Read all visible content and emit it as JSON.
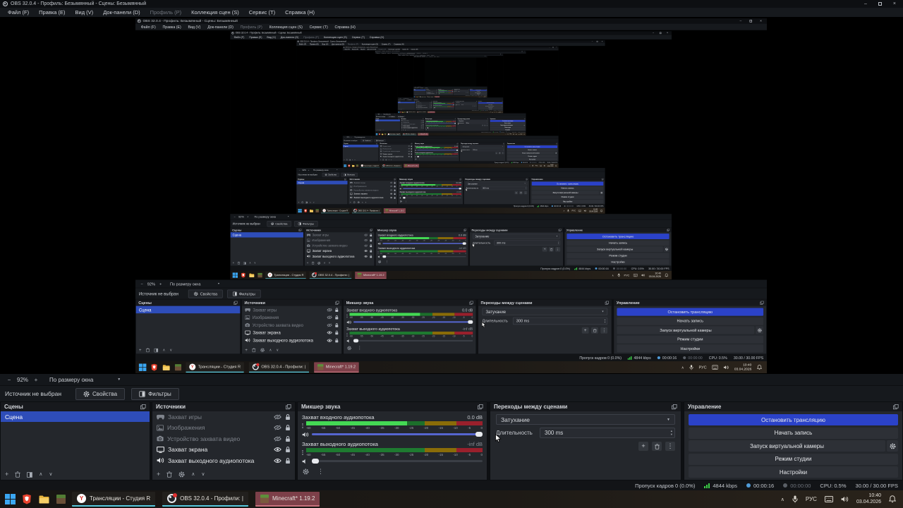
{
  "window": {
    "title": "OBS 32.0.4 - Профиль: Безымянный - Сцены: Безымянный",
    "menu": {
      "file": "Файл (F)",
      "edit": "Правка (E)",
      "view": "Вид (V)",
      "docks": "Док-панели (D)",
      "profile": "Профиль (P)",
      "scene_collection": "Коллекция сцен (S)",
      "tools": "Сервис (T)",
      "help": "Справка (H)"
    },
    "controls": {
      "minimize": "–",
      "close": "×"
    }
  },
  "preview_toolbar": {
    "zoom_out": "−",
    "zoom_level": "92%",
    "zoom_in": "+",
    "fit_mode": "По размеру окна"
  },
  "context_bar": {
    "status": "Источник не выбран",
    "properties": "Свойства",
    "filters": "Фильтры"
  },
  "scenes": {
    "title": "Сцены",
    "items": [
      {
        "name": "Сцена",
        "selected": true
      }
    ]
  },
  "sources": {
    "title": "Источники",
    "items": [
      {
        "name": "Захват игры",
        "visible": false,
        "locked": true
      },
      {
        "name": "Изображения",
        "visible": false,
        "locked": true
      },
      {
        "name": "Устройство захвата видео",
        "visible": false,
        "locked": true
      },
      {
        "name": "Захват экрана",
        "visible": true,
        "locked": true
      },
      {
        "name": "Захват выходного аудиопотока",
        "visible": true,
        "locked": true
      }
    ]
  },
  "mixer": {
    "title": "Микшер звука",
    "channel1": {
      "name": "Захват входного аудиопотока",
      "db": "0.0 dB",
      "level_pct": 57,
      "volume_pct": 100
    },
    "channel2": {
      "name": "Захват выходного аудиопотока",
      "db": "-inf dB",
      "level_pct": 0,
      "volume_pct": 0
    },
    "ticks": [
      "-60",
      "-55",
      "-50",
      "-45",
      "-40",
      "-35",
      "-30",
      "-25",
      "-20",
      "-15",
      "-10",
      "-5",
      "0"
    ]
  },
  "transitions": {
    "title": "Переходы между сценами",
    "current": "Затухание",
    "duration_label": "Длительность",
    "duration_value": "300 ms"
  },
  "controls_dock": {
    "title": "Управление",
    "stop_stream": "Остановить трансляцию",
    "start_record": "Начать запись",
    "virtual_camera": "Запуск виртуальной камеры",
    "studio_mode": "Режим студии",
    "settings": "Настройки"
  },
  "status_bar": {
    "dropped_frames": "Пропуск кадров 0 (0.0%)",
    "bitrate": "4844 kbps",
    "stream_time": "00:00:16",
    "record_time": "00:00:00",
    "cpu": "CPU: 0.5%",
    "fps": "30.00 / 30.00 FPS"
  },
  "taskbar": {
    "studio_button": "Трансляции - Студия R",
    "obs_button": "OBS 32.0.4 - Профили: |",
    "minecraft_button": "Minecraft* 1.19.2",
    "lang": "РУС",
    "time": "10:40",
    "date": "03.04.2026"
  },
  "icons": {
    "properties": "gear",
    "filters": "filter-panel",
    "scene_add": "plus",
    "trash": "trash-can",
    "visible": "eye",
    "hidden": "eye-slash",
    "locked": "padlock",
    "stream_status": "blue-dot",
    "record_status": "gray-dot",
    "bitrate_status": "green-signal-bars"
  },
  "colors": {
    "accent_blue": "#2b42c8",
    "selection_blue": "#2e4db9",
    "meter_green_lit": "#44d954",
    "meter_green": "#1c6f2b",
    "meter_yellow": "#8a6c08",
    "meter_red": "#99202c",
    "bitrate_green": "#3bd147",
    "attention_red": "#7d4049"
  }
}
